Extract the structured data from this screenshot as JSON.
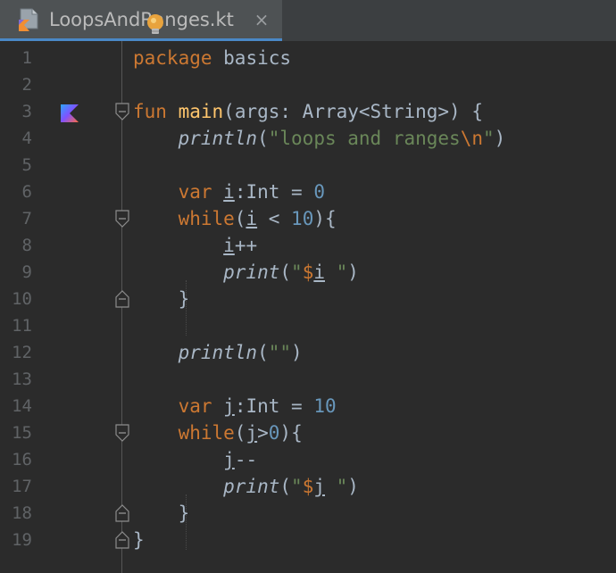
{
  "tab": {
    "title": "LoopsAndRanges.kt",
    "close": "×"
  },
  "editor": {
    "lines": [
      {
        "num": "1",
        "segs": [
          {
            "t": "package",
            "c": "kw"
          },
          {
            "t": " basics",
            "c": ""
          }
        ]
      },
      {
        "num": "2",
        "segs": []
      },
      {
        "num": "3",
        "segs": [
          {
            "t": "fun",
            "c": "kw"
          },
          {
            "t": " ",
            "c": ""
          },
          {
            "t": "main",
            "c": "fn"
          },
          {
            "t": "(args: Array<String>) {",
            "c": ""
          }
        ],
        "run": true,
        "fold": "open"
      },
      {
        "num": "4",
        "segs": [
          {
            "t": "    ",
            "c": ""
          },
          {
            "t": "println",
            "c": "call"
          },
          {
            "t": "(",
            "c": ""
          },
          {
            "t": "\"loops and ranges",
            "c": "str"
          },
          {
            "t": "\\n",
            "c": "esc"
          },
          {
            "t": "\"",
            "c": "str"
          },
          {
            "t": ")",
            "c": ""
          }
        ]
      },
      {
        "num": "5",
        "segs": []
      },
      {
        "num": "6",
        "segs": [
          {
            "t": "    ",
            "c": ""
          },
          {
            "t": "var",
            "c": "kw"
          },
          {
            "t": " ",
            "c": ""
          },
          {
            "t": "i",
            "c": "u"
          },
          {
            "t": ":Int = ",
            "c": ""
          },
          {
            "t": "0",
            "c": "num"
          }
        ]
      },
      {
        "num": "7",
        "segs": [
          {
            "t": "    ",
            "c": ""
          },
          {
            "t": "while",
            "c": "kw"
          },
          {
            "t": "(",
            "c": ""
          },
          {
            "t": "i",
            "c": "u"
          },
          {
            "t": " < ",
            "c": ""
          },
          {
            "t": "10",
            "c": "num"
          },
          {
            "t": "){",
            "c": ""
          }
        ],
        "fold": "open"
      },
      {
        "num": "8",
        "segs": [
          {
            "t": "        ",
            "c": ""
          },
          {
            "t": "i",
            "c": "u"
          },
          {
            "t": "++",
            "c": ""
          }
        ]
      },
      {
        "num": "9",
        "segs": [
          {
            "t": "        ",
            "c": ""
          },
          {
            "t": "print",
            "c": "call"
          },
          {
            "t": "(",
            "c": ""
          },
          {
            "t": "\"",
            "c": "str"
          },
          {
            "t": "$",
            "c": "esc"
          },
          {
            "t": "i",
            "c": "u"
          },
          {
            "t": " \"",
            "c": "str"
          },
          {
            "t": ")",
            "c": ""
          }
        ]
      },
      {
        "num": "10",
        "segs": [
          {
            "t": "    }",
            "c": ""
          }
        ],
        "fold": "close"
      },
      {
        "num": "11",
        "segs": []
      },
      {
        "num": "12",
        "segs": [
          {
            "t": "    ",
            "c": ""
          },
          {
            "t": "println",
            "c": "call"
          },
          {
            "t": "(",
            "c": ""
          },
          {
            "t": "\"\"",
            "c": "str"
          },
          {
            "t": ")",
            "c": ""
          }
        ]
      },
      {
        "num": "13",
        "segs": []
      },
      {
        "num": "14",
        "segs": [
          {
            "t": "    ",
            "c": ""
          },
          {
            "t": "var",
            "c": "kw"
          },
          {
            "t": " ",
            "c": ""
          },
          {
            "t": "j",
            "c": "u"
          },
          {
            "t": ":Int = ",
            "c": ""
          },
          {
            "t": "10",
            "c": "num"
          }
        ]
      },
      {
        "num": "15",
        "segs": [
          {
            "t": "    ",
            "c": ""
          },
          {
            "t": "while",
            "c": "kw"
          },
          {
            "t": "(",
            "c": ""
          },
          {
            "t": "j",
            "c": "u"
          },
          {
            "t": ">",
            "c": ""
          },
          {
            "t": "0",
            "c": "num"
          },
          {
            "t": "){",
            "c": ""
          }
        ],
        "fold": "open"
      },
      {
        "num": "16",
        "segs": [
          {
            "t": "        ",
            "c": ""
          },
          {
            "t": "j",
            "c": "u"
          },
          {
            "t": "--",
            "c": ""
          }
        ]
      },
      {
        "num": "17",
        "segs": [
          {
            "t": "        ",
            "c": ""
          },
          {
            "t": "print",
            "c": "call"
          },
          {
            "t": "(",
            "c": ""
          },
          {
            "t": "\"",
            "c": "str"
          },
          {
            "t": "$",
            "c": "esc"
          },
          {
            "t": "j",
            "c": "u"
          },
          {
            "t": " \"",
            "c": "str"
          },
          {
            "t": ")",
            "c": ""
          }
        ]
      },
      {
        "num": "18",
        "segs": [
          {
            "t": "    }",
            "c": ""
          }
        ],
        "fold": "close"
      },
      {
        "num": "19",
        "segs": [
          {
            "t": "}",
            "c": ""
          }
        ],
        "fold": "close"
      }
    ]
  },
  "icons": {
    "file": "kotlin-file-icon",
    "bulb": "lightbulb-icon",
    "run": "kotlin-run-icon",
    "fold": "fold-marker-icon",
    "close": "close-icon"
  },
  "colors": {
    "background": "#2b2b2b",
    "tab_bar": "#3c3f41",
    "active_tab": "#4e5254",
    "tab_underline": "#4a88c7",
    "keyword": "#cc7832",
    "function_decl": "#ffc66d",
    "string": "#6a8759",
    "number": "#6897bb",
    "text": "#a9b7c6",
    "line_number": "#606366"
  }
}
